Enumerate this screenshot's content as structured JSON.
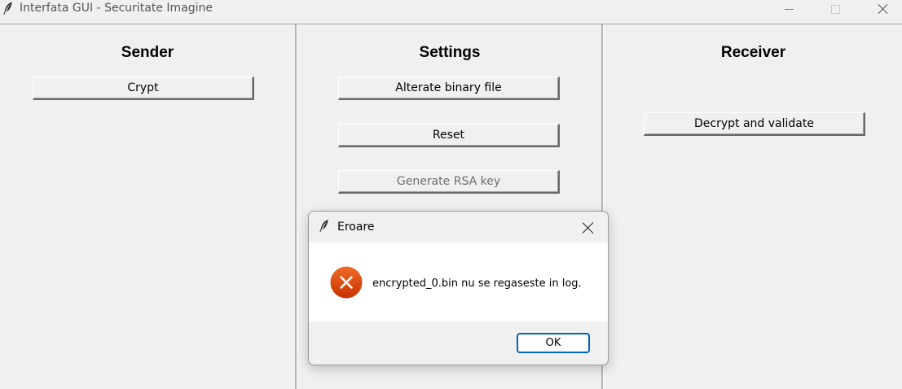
{
  "window": {
    "title": "Interfata GUI - Securitate Imagine"
  },
  "sender": {
    "heading": "Sender",
    "crypt_label": "Crypt"
  },
  "settings": {
    "heading": "Settings",
    "alterate_label": "Alterate binary file",
    "reset_label": "Reset",
    "generate_label": "Generate RSA key",
    "generate_disabled": true
  },
  "receiver": {
    "heading": "Receiver",
    "decrypt_label": "Decrypt and validate"
  },
  "dialog": {
    "title": "Eroare",
    "message": "encrypted_0.bin nu se regaseste in log.",
    "ok_label": "OK",
    "icon": "error-icon",
    "error_color": "#d83b01"
  },
  "colors": {
    "window_bg": "#f0f0f0",
    "dialog_body_bg": "#ffffff",
    "ok_border": "#0067c0"
  }
}
